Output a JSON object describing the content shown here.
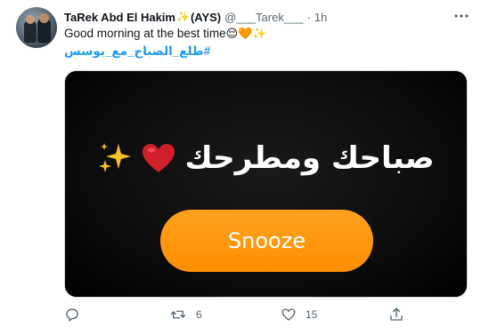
{
  "tweet": {
    "author": {
      "display_name": "TaRek Abd El Hakim",
      "name_emoji": "✨",
      "name_suffix": "(AYS)",
      "handle": "@___Tarek___",
      "separator": "·",
      "time": "1h"
    },
    "text": "Good morning at the best time",
    "text_emojis": "😌🧡✨",
    "hashtag": "#طلع_الصباح_مع_بوسس",
    "media": {
      "arabic_text": "صباحك ومطرحك",
      "heart_emoji": "❤️",
      "sparkles_emoji": "✨",
      "snooze_label": "Snooze",
      "accent": "#ff9a12"
    },
    "actions": {
      "reply_count": "",
      "retweet_count": "6",
      "like_count": "15"
    }
  }
}
